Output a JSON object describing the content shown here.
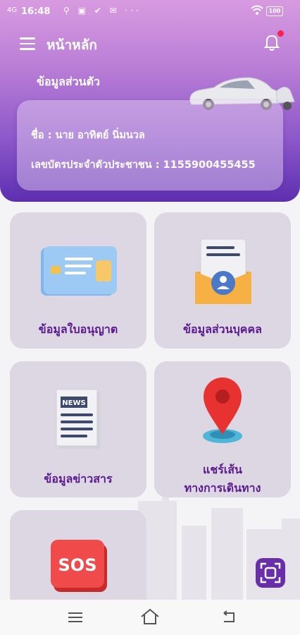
{
  "status_bar": {
    "network": "4G",
    "time": "16:48",
    "icons": "⚲ ▣ ✔ ✉ ···",
    "battery": "100"
  },
  "header": {
    "title": "หน้าหลัก",
    "section_title": "ข้อมูลส่วนตัว"
  },
  "profile": {
    "name_line": "ชื่อ : นาย อาทิตย์ นิ่มนวล",
    "id_line": "เลขบัตรประจำตัวประชาชน : 1155900455455"
  },
  "menu": [
    {
      "label": "ข้อมูลใบอนุญาต",
      "icon": "id-card-icon"
    },
    {
      "label": "ข้อมูลส่วนบุคคล",
      "icon": "profile-document-icon"
    },
    {
      "label": "ข้อมูลข่าวสาร",
      "icon": "news-icon"
    },
    {
      "label_line1": "แชร์เส้น",
      "label_line2": "ทางการเดินทาง",
      "icon": "location-pin-icon"
    },
    {
      "label": "SOS",
      "icon": "sos-icon"
    }
  ],
  "colors": {
    "accent": "#5a1a8e",
    "header_top": "#d89be0",
    "header_bottom": "#5d2fb0",
    "tile_bg": "#ddd7e3",
    "notification": "#ff1f4b"
  }
}
